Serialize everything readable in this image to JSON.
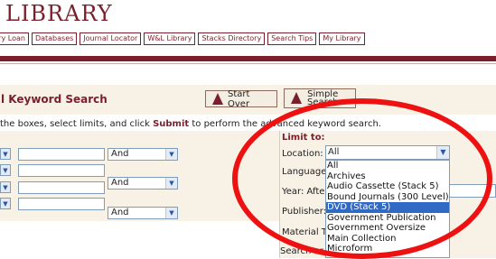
{
  "header": {
    "logo": "LIBRARY",
    "nav_tabs": [
      "rary Loan",
      "Databases",
      "Journal Locator",
      "W&L Library",
      "Stacks Directory",
      "Search Tips",
      "My Library"
    ]
  },
  "search": {
    "title": "l Keyword Search",
    "start_over": "Start Over",
    "simple_search_1": "Simple",
    "simple_search_2": "Search",
    "instruction_pre": " the boxes, select limits, and click ",
    "instruction_bold": "Submit",
    "instruction_post": " to perform the advanced keyword search.",
    "operator_1": "And",
    "operator_2": "And",
    "operator_3": "And"
  },
  "limits": {
    "title": "Limit to:",
    "location_label": "Location:",
    "location_value": "All",
    "language_label": "Language",
    "year_label": "Year: Afte",
    "publisher_label": "Publisher:",
    "material_label": "Material T",
    "search_label": "Search ar"
  },
  "location_options": [
    "All",
    "Archives",
    "Audio Cassette (Stack 5)",
    "Bound Journals (300 Level)",
    "DVD (Stack 5)",
    "Government Publication",
    "Government Oversize",
    "Main Collection",
    "Microform"
  ],
  "selected_option": "DVD (Stack 5)",
  "annotation": {
    "color": "#ee1111"
  },
  "colors": {
    "brand": "#7a1f2b",
    "highlight": "#316ac5"
  }
}
